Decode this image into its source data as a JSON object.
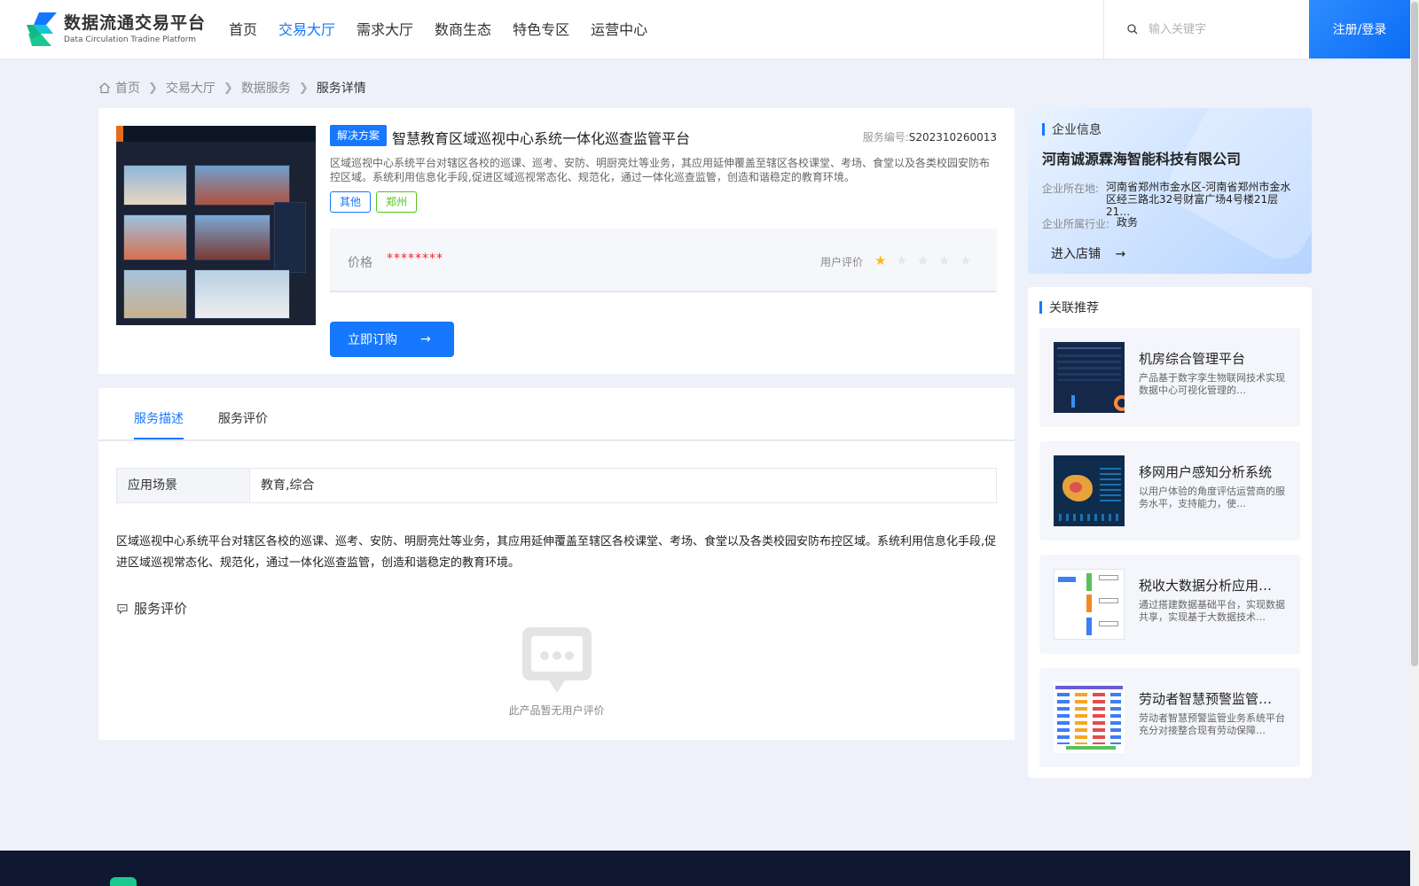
{
  "header": {
    "logo_cn": "数据流通交易平台",
    "logo_en": "Data Circulation Tradine Platform",
    "nav": [
      {
        "label": "首页"
      },
      {
        "label": "交易大厅",
        "active": true
      },
      {
        "label": "需求大厅"
      },
      {
        "label": "数商生态"
      },
      {
        "label": "特色专区"
      },
      {
        "label": "运营中心"
      }
    ],
    "search_placeholder": "输入关键字",
    "login_label": "注册/登录"
  },
  "breadcrumb": [
    "首页",
    "交易大厅",
    "数据服务",
    "服务详情"
  ],
  "product": {
    "badge": "解决方案",
    "title": "智慧教育区域巡视中心系统一体化巡查监管平台",
    "service_no_label": "服务编号:",
    "service_no": "S202310260013",
    "description": "区域巡视中心系统平台对辖区各校的巡课、巡考、安防、明厨亮灶等业务，其应用延伸覆盖至辖区各校课堂、考场、食堂以及各类校园安防布控区域。系统利用信息化手段,促进区域巡视常态化、规范化，通过一体化巡查监管，创造和谐稳定的教育环境。",
    "tags": [
      "其他",
      "郑州"
    ],
    "price_label": "价格",
    "price_value": "********",
    "rating_label": "用户评价",
    "rating": 1,
    "rating_max": 5,
    "order_label": "立即订购"
  },
  "detail": {
    "tabs": [
      "服务描述",
      "服务评价"
    ],
    "scene_label": "应用场景",
    "scene_value": "教育,综合",
    "long_description": "区域巡视中心系统平台对辖区各校的巡课、巡考、安防、明厨亮灶等业务，其应用延伸覆盖至辖区各校课堂、考场、食堂以及各类校园安防布控区域。系统利用信息化手段,促进区域巡视常态化、规范化，通过一体化巡查监管，创造和谐稳定的教育环境。",
    "review_title": "服务评价",
    "empty_review": "此产品暂无用户评价"
  },
  "enterprise": {
    "section_title": "企业信息",
    "name": "河南诚源霖海智能科技有限公司",
    "location_label": "企业所在地:",
    "location": "河南省郑州市金水区-河南省郑州市金水区经三路北32号财富广场4号楼21层21…",
    "industry_label": "企业所属行业:",
    "industry": "政务",
    "enter_label": "进入店铺"
  },
  "related": {
    "section_title": "关联推荐",
    "items": [
      {
        "name": "机房综合管理平台",
        "desc": "产品基于数字孪生物联网技术实现数据中心可视化管理的…"
      },
      {
        "name": "移网用户感知分析系统",
        "desc": "以用户体验的角度评估运营商的服务水平，支持能力，使…"
      },
      {
        "name": "税收大数据分析应用…",
        "desc": "通过搭建数据基础平台，实现数据共享，实现基于大数据技术…"
      },
      {
        "name": "劳动者智慧预警监管…",
        "desc": "劳动者智慧预警监管业务系统平台充分对接整合现有劳动保障…"
      }
    ]
  },
  "colors": {
    "primary": "#1677ff",
    "price": "#f5222d",
    "star": "#fbb917",
    "tag_green": "#52c41a"
  }
}
